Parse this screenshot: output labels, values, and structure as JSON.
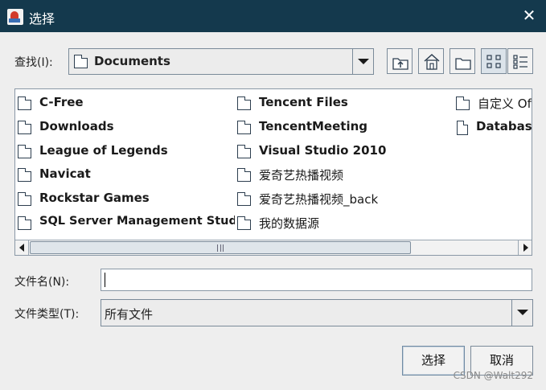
{
  "window": {
    "title": "选择",
    "close_glyph": "✕",
    "icon": "java-app-icon"
  },
  "look_in": {
    "label": "查找(I):",
    "value": "Documents"
  },
  "toolbar": {
    "buttons": [
      {
        "name": "up-one-level-button",
        "icon": "up-folder-icon"
      },
      {
        "name": "home-button",
        "icon": "home-icon"
      },
      {
        "name": "new-folder-button",
        "icon": "new-folder-icon"
      },
      {
        "name": "list-view-button",
        "icon": "list-view-icon",
        "active": true
      },
      {
        "name": "details-view-button",
        "icon": "details-view-icon"
      }
    ]
  },
  "files": {
    "column1": [
      "C-Free",
      "Downloads",
      "League of Legends",
      "Navicat",
      "Rockstar Games",
      "SQL Server Management Studio"
    ],
    "column2": [
      "Tencent Files",
      "TencentMeeting",
      "Visual Studio 2010",
      "爱奇艺热播视频",
      "爱奇艺热播视频_back",
      "我的数据源"
    ],
    "column3": [
      {
        "name": "自定义 Of",
        "type": "folder"
      },
      {
        "name": "Database",
        "type": "file"
      }
    ]
  },
  "file_name": {
    "label": "文件名(N):",
    "value": ""
  },
  "file_type": {
    "label": "文件类型(T):",
    "value": "所有文件"
  },
  "buttons": {
    "select": "选择",
    "cancel": "取消"
  },
  "watermark": "CSDN @Walt292",
  "colors": {
    "titlebar": "#14394d",
    "dialog_bg": "#eeeeee"
  }
}
